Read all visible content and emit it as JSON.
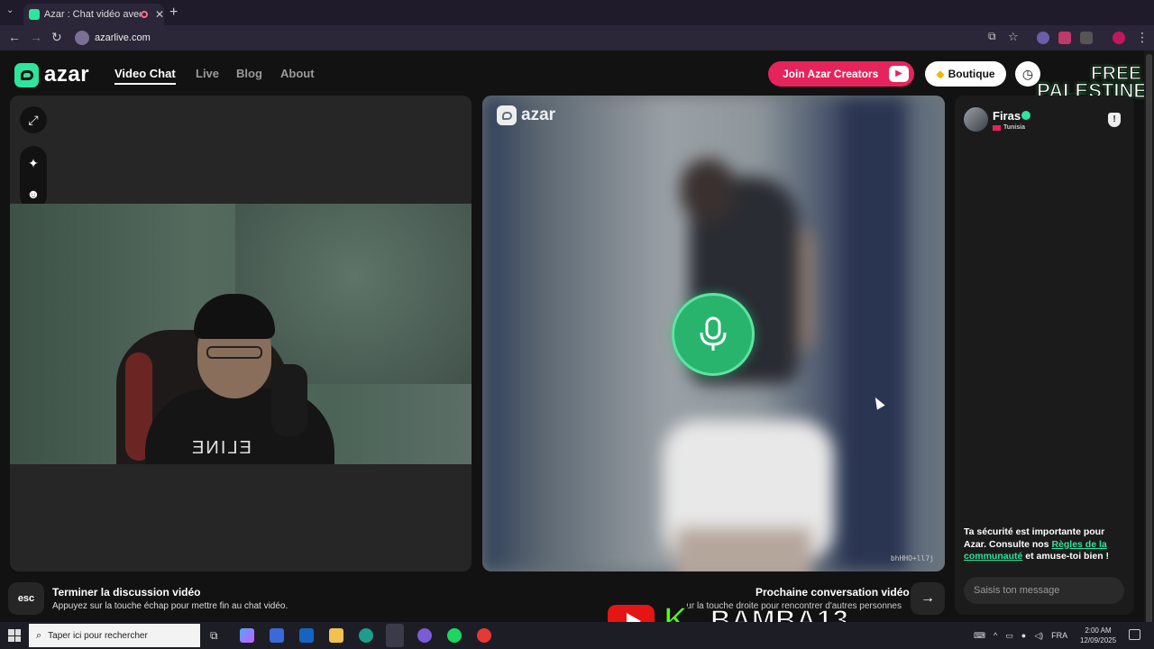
{
  "browser": {
    "tab_title": "Azar : Chat vidéo avec de nouvelles personnes",
    "url": "azarlive.com",
    "new_tab_label": "+",
    "close_tab_label": "✕"
  },
  "site": {
    "brand": "azar",
    "nav": [
      "Video Chat",
      "Live",
      "Blog",
      "About"
    ],
    "active_nav": "Video Chat",
    "creators_label": "Join Azar Creators",
    "boutique_label": "Boutique",
    "overlay_line1": "FREE",
    "overlay_line2": "PALESTINE"
  },
  "call": {
    "partner_name": "Firas",
    "partner_country": "Tunisia",
    "watermark_code": "bhHHO+ll7j"
  },
  "chat": {
    "safety_text_1": "Ta sécurité est importante pour Azar. Consulte nos ",
    "safety_link": "Règles de la communauté",
    "safety_text_2": " et amuse-toi bien !",
    "input_placeholder": "Saisis ton message"
  },
  "controls": {
    "esc_label": "esc",
    "end_title": "Terminer la discussion vidéo",
    "end_subtitle": "Appuyez sur la touche échap pour mettre fin au chat vidéo.",
    "next_title": "Prochaine conversation vidéo",
    "next_subtitle": "ur la touche droite pour rencontrer d'autres personnes"
  },
  "stream_overlay": {
    "kick_letter": "K",
    "streamer_name": "BAMBA13"
  },
  "taskbar": {
    "search_placeholder": "Taper ici pour rechercher",
    "language": "FRA",
    "time": "2:00 AM",
    "date": "12/09/2025"
  },
  "colors": {
    "accent": "#2ee59d",
    "creators_red": "#e5245b",
    "mic_green": "#28b46d"
  }
}
